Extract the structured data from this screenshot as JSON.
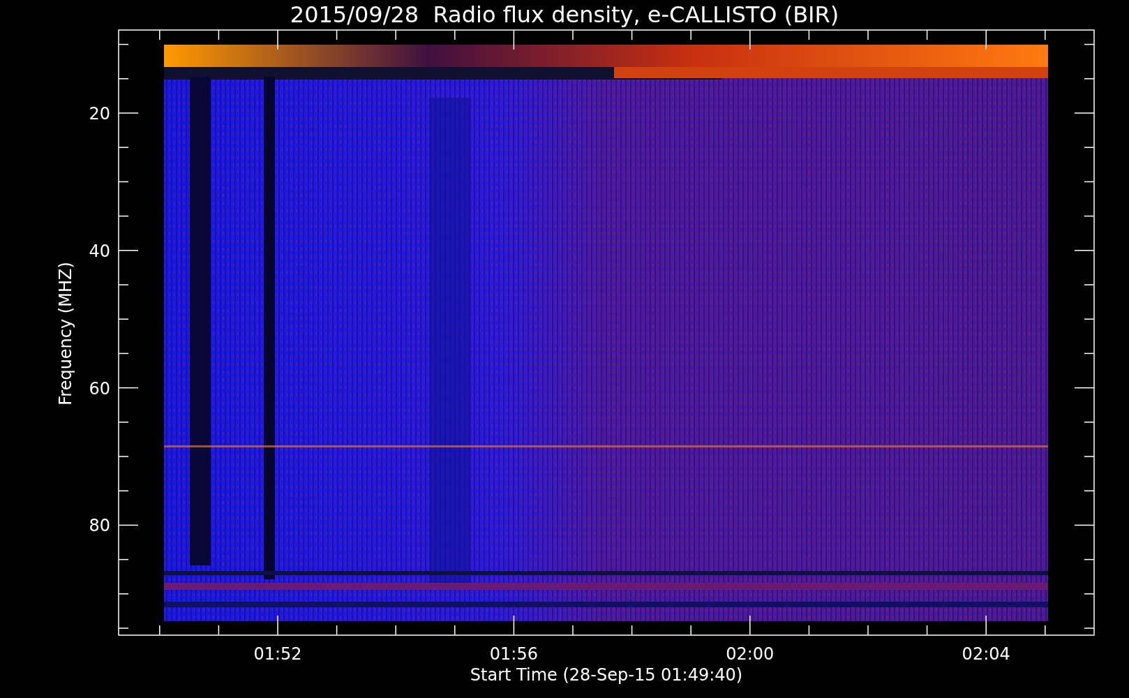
{
  "title": "2015/09/28  Radio flux density, e-CALLISTO (BIR)",
  "y_axis": {
    "label": "Frequency (MHZ)",
    "tick_labels": [
      "20",
      "40",
      "60",
      "80"
    ]
  },
  "x_axis": {
    "label": "Start Time (28-Sep-15 01:49:40)",
    "tick_labels": [
      "01:52",
      "01:56",
      "02:00",
      "02:04"
    ]
  }
}
